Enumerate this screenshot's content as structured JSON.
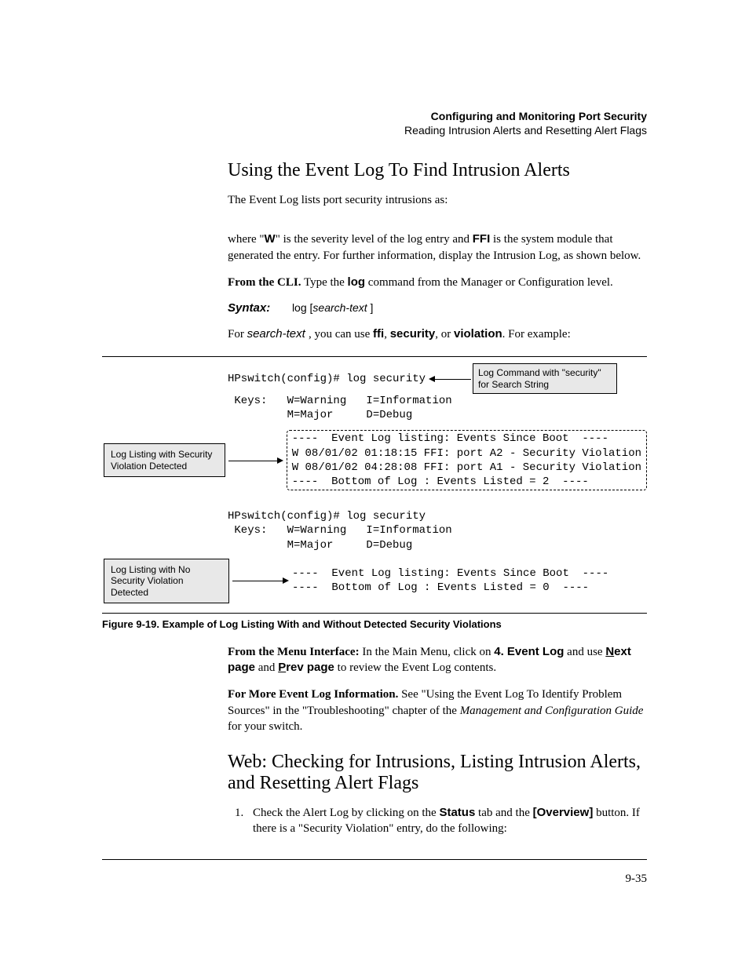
{
  "runhead": {
    "title": "Configuring and Monitoring Port Security",
    "subtitle": "Reading Intrusion Alerts and Resetting Alert Flags"
  },
  "s1": {
    "heading": "Using the Event Log To Find Intrusion Alerts",
    "p1": "The Event Log lists port security intrusions as:",
    "p2a": "where \"",
    "p2b": "W",
    "p2c": "\" is the severity level of the log entry and ",
    "p2d": "FFI",
    "p2e": " is the system module that generated the entry. For further information, display the Intrusion Log, as shown below.",
    "p3a": "From the CLI.",
    "p3b": " Type the ",
    "p3c": "log",
    "p3d": " command from the Manager or Configuration level.",
    "syntax_label": "Syntax:",
    "syntax_cmd_a": "log [",
    "syntax_cmd_b": "search-text ",
    "syntax_cmd_c": "]",
    "p4a": "For ",
    "p4b": "search-text ",
    "p4c": ", you can use ",
    "p4d": "ffi",
    "p4e": ", ",
    "p4f": "security",
    "p4g": ", or ",
    "p4h": "violation",
    "p4i": ". For example:"
  },
  "figure": {
    "left1": "Log Listing with Security Violation Detected",
    "left2": "Log Listing with No Security Violation Detected",
    "right1": "Log Command with \"security\" for Search String",
    "cli1_cmd": "HPswitch(config)# log security",
    "cli_keys": " Keys:   W=Warning   I=Information",
    "cli_keys2": "         M=Major     D=Debug",
    "box1_l1": "----  Event Log listing: Events Since Boot  ----",
    "box1_l2": "W 08/01/02 01:18:15 FFI: port A2 - Security Violation",
    "box1_l3": "W 08/01/02 04:28:08 FFI: port A1 - Security Violation",
    "box1_l4": "----  Bottom of Log : Events Listed = 2  ----",
    "cli2_cmd": "HPswitch(config)# log security",
    "box2_l1": "----  Event Log listing: Events Since Boot  ----",
    "box2_l2": "----  Bottom of Log : Events Listed = 0  ----",
    "caption": "Figure 9-19. Example of Log Listing With and Without Detected Security Violations"
  },
  "after": {
    "p5a": "From the Menu Interface:",
    "p5b": " In the Main Menu, click on ",
    "p5c": "4. Event Log",
    "p5d": " and use ",
    "p5e_u": "N",
    "p5e_r": "ext page",
    "p5f": " and ",
    "p5g_u": "P",
    "p5g_r": "rev page",
    "p5h": " to review the Event Log contents.",
    "p6a": "For More Event Log Information.",
    "p6b": " See \"Using the Event Log To Identify Problem Sources\" in the \"Troubleshooting\" chapter of the ",
    "p6c": "Management and Configuration Guide",
    "p6d": " for your switch."
  },
  "s2": {
    "heading": "Web: Checking for Intrusions, Listing Intrusion Alerts, and Resetting Alert Flags",
    "step1a": "Check the Alert Log by clicking on the ",
    "step1b": "Status",
    "step1c": " tab and the ",
    "step1d": "[Overview]",
    "step1e": " button. If there is a \"Security Violation\" entry, do the following:"
  },
  "pagenum": "9-35"
}
